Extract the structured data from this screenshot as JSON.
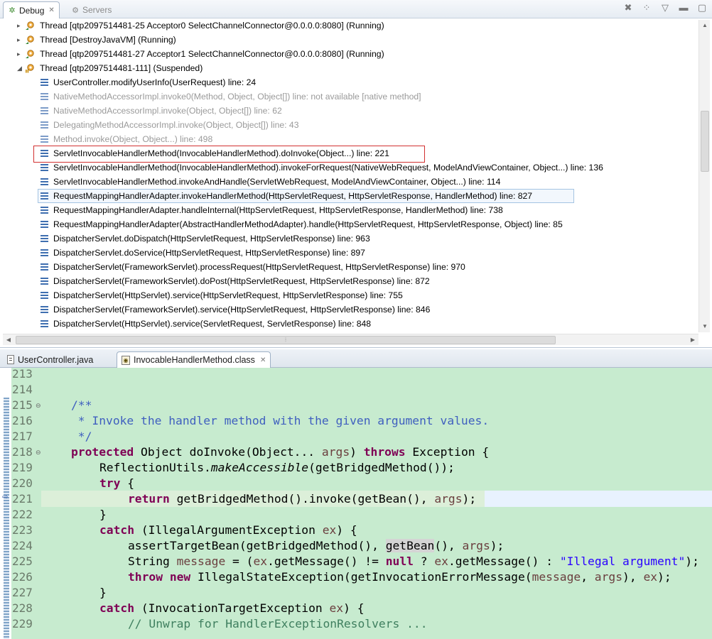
{
  "debug_view": {
    "tabs": [
      {
        "label": "Debug",
        "icon": "bug-icon",
        "closable": true,
        "active": true
      },
      {
        "label": "Servers",
        "icon": "servers-icon",
        "closable": false,
        "active": false
      }
    ],
    "toolbar_icons": [
      "remove-terminated-icon",
      "threads-icon",
      "view-menu-icon",
      "minimize-icon",
      "maximize-icon"
    ],
    "threads_top": [
      {
        "label": "Thread [qtp2097514481-25 Acceptor0 SelectChannelConnector@0.0.0.0:8080] (Running)"
      },
      {
        "label": "Thread [DestroyJavaVM] (Running)"
      },
      {
        "label": "Thread [qtp2097514481-27 Acceptor1 SelectChannelConnector@0.0.0.0:8080] (Running)"
      }
    ],
    "suspended_thread": {
      "label": "Thread [qtp2097514481-111] (Suspended)"
    },
    "frames": [
      {
        "label": "UserController.modifyUserInfo(UserRequest) line: 24",
        "dim": false
      },
      {
        "label": "NativeMethodAccessorImpl.invoke0(Method, Object, Object[]) line: not available [native method]",
        "dim": true
      },
      {
        "label": "NativeMethodAccessorImpl.invoke(Object, Object[]) line: 62",
        "dim": true
      },
      {
        "label": "DelegatingMethodAccessorImpl.invoke(Object, Object[]) line: 43",
        "dim": true
      },
      {
        "label": "Method.invoke(Object, Object...) line: 498",
        "dim": true
      },
      {
        "label": "ServletInvocableHandlerMethod(InvocableHandlerMethod).doInvoke(Object...) line: 221",
        "dim": false
      },
      {
        "label": "ServletInvocableHandlerMethod(InvocableHandlerMethod).invokeForRequest(NativeWebRequest, ModelAndViewContainer, Object...) line: 136",
        "dim": false
      },
      {
        "label": "ServletInvocableHandlerMethod.invokeAndHandle(ServletWebRequest, ModelAndViewContainer, Object...) line: 114",
        "dim": false
      },
      {
        "label": "RequestMappingHandlerAdapter.invokeHandlerMethod(HttpServletRequest, HttpServletResponse, HandlerMethod) line: 827",
        "dim": false
      },
      {
        "label": "RequestMappingHandlerAdapter.handleInternal(HttpServletRequest, HttpServletResponse, HandlerMethod) line: 738",
        "dim": false
      },
      {
        "label": "RequestMappingHandlerAdapter(AbstractHandlerMethodAdapter).handle(HttpServletRequest, HttpServletResponse, Object) line: 85",
        "dim": false
      },
      {
        "label": "DispatcherServlet.doDispatch(HttpServletRequest, HttpServletResponse) line: 963",
        "dim": false
      },
      {
        "label": "DispatcherServlet.doService(HttpServletRequest, HttpServletResponse) line: 897",
        "dim": false
      },
      {
        "label": "DispatcherServlet(FrameworkServlet).processRequest(HttpServletRequest, HttpServletResponse) line: 970",
        "dim": false
      },
      {
        "label": "DispatcherServlet(FrameworkServlet).doPost(HttpServletRequest, HttpServletResponse) line: 872",
        "dim": false
      },
      {
        "label": "DispatcherServlet(HttpServlet).service(HttpServletRequest, HttpServletResponse) line: 755",
        "dim": false
      },
      {
        "label": "DispatcherServlet(FrameworkServlet).service(HttpServletRequest, HttpServletResponse) line: 846",
        "dim": false
      },
      {
        "label": "DispatcherServlet(HttpServlet).service(ServletRequest, ServletResponse) line: 848",
        "dim": false
      }
    ]
  },
  "editor": {
    "tabs": [
      {
        "label": "UserController.java",
        "icon": "java-file-icon",
        "active": false
      },
      {
        "label": "InvocableHandlerMethod.class",
        "icon": "class-file-icon",
        "active": true,
        "closable": true
      }
    ],
    "line_numbers": [
      "213",
      "214",
      "215",
      "216",
      "217",
      "218",
      "219",
      "220",
      "221",
      "222",
      "223",
      "224",
      "225",
      "226",
      "227",
      "228",
      "229"
    ],
    "code": {
      "l215": "/**",
      "l216": " * Invoke the handler method with the given argument values.",
      "l217": " */",
      "l218_kw": "protected",
      "l218_a": " Object doInvoke(Object... ",
      "l218_var": "args",
      "l218_b": ") ",
      "l218_kw2": "throws",
      "l218_c": " Exception {",
      "l219_a": "ReflectionUtils.",
      "l219_it": "makeAccessible",
      "l219_b": "(getBridgedMethod());",
      "l220_kw": "try",
      "l220_a": " {",
      "l221_kw": "return",
      "l221_a": " getBridgedMethod().invoke(getBean(), ",
      "l221_var": "args",
      "l221_b": ");",
      "l222": "}",
      "l223_kw": "catch",
      "l223_a": " (IllegalArgumentException ",
      "l223_var": "ex",
      "l223_b": ") {",
      "l224_a": "assertTargetBean(getBridgedMethod(), ",
      "l224_occ": "getBean",
      "l224_b": "(), ",
      "l224_var": "args",
      "l224_c": ");",
      "l225_a": "String ",
      "l225_var": "message",
      "l225_b": " = (",
      "l225_var2": "ex",
      "l225_c": ".getMessage() != ",
      "l225_kw": "null",
      "l225_d": " ? ",
      "l225_var3": "ex",
      "l225_e": ".getMessage() : ",
      "l225_str": "\"Illegal argument\"",
      "l225_f": ");",
      "l226_kw": "throw",
      "l226_kw2": "new",
      "l226_a": " IllegalStateException(getInvocationErrorMessage(",
      "l226_var": "message",
      "l226_b": ", ",
      "l226_var2": "args",
      "l226_c": "), ",
      "l226_var3": "ex",
      "l226_d": ");",
      "l227": "}",
      "l228_kw": "catch",
      "l228_a": " (InvocationTargetException ",
      "l228_var": "ex",
      "l228_b": ") {",
      "l229": "// Unwrap for HandlerExceptionResolvers ..."
    }
  }
}
